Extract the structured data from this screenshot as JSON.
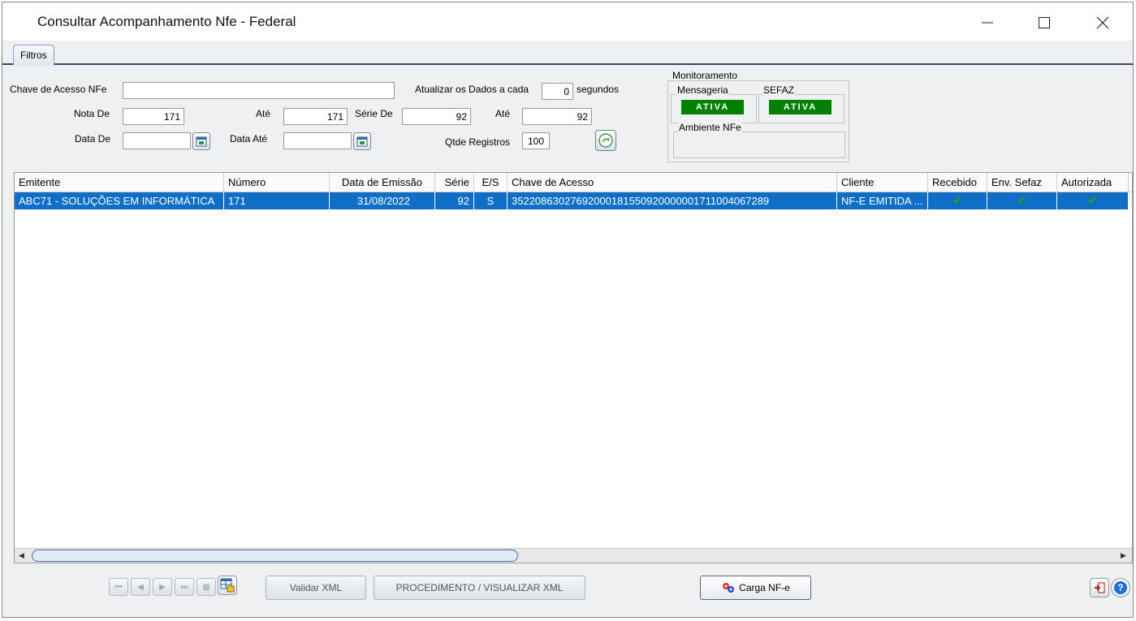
{
  "window": {
    "title": "Consultar Acompanhamento Nfe - Federal"
  },
  "tabs": [
    {
      "label": "Filtros"
    }
  ],
  "filters": {
    "chave_label": "Chave de Acesso NFe",
    "chave_value": "",
    "atualizar_label": "Atualizar os Dados a cada",
    "atualizar_value": "0",
    "segundos_label": "segundos",
    "nota_de_label": "Nota De",
    "nota_de_value": "171",
    "nota_ate_label": "Até",
    "nota_ate_value": "171",
    "serie_de_label": "Série De",
    "serie_de_value": "92",
    "serie_ate_label": "Até",
    "serie_ate_value": "92",
    "data_de_label": "Data De",
    "data_de_value": "",
    "data_ate_label": "Data Até",
    "data_ate_value": "",
    "qtde_label": "Qtde Registros",
    "qtde_value": "100"
  },
  "monitoramento": {
    "title": "Monitoramento",
    "mensageria_label": "Mensageria",
    "mensageria_status": "ATIVA",
    "sefaz_label": "SEFAZ",
    "sefaz_status": "ATIVA",
    "ambiente_label": "Ambiente NFe",
    "ambiente_value": "",
    "status_color": "#008000"
  },
  "grid": {
    "columns": [
      "Emitente",
      "Número",
      "Data de Emissão",
      "Série",
      "E/S",
      "Chave de Acesso",
      "Cliente",
      "Recebido",
      "Env. Sefaz",
      "Autorizada"
    ],
    "rows": [
      {
        "emitente": "ABC71 - SOLUÇÕES EM INFORMÁTICA",
        "numero": "171",
        "data_emissao": "31/08/2022",
        "serie": "92",
        "es": "S",
        "chave": "35220863027692000181550920000001711004067289",
        "cliente": "NF-E EMITIDA ...",
        "recebido": "✔",
        "env_sefaz": "✔",
        "autorizada": "✔"
      }
    ],
    "selection_color": "#0f6fc6"
  },
  "footer": {
    "validar_label": "Validar XML",
    "procedimento_label": "PROCEDIMENTO / VISUALIZAR XML",
    "carga_label": "Carga NF-e"
  }
}
